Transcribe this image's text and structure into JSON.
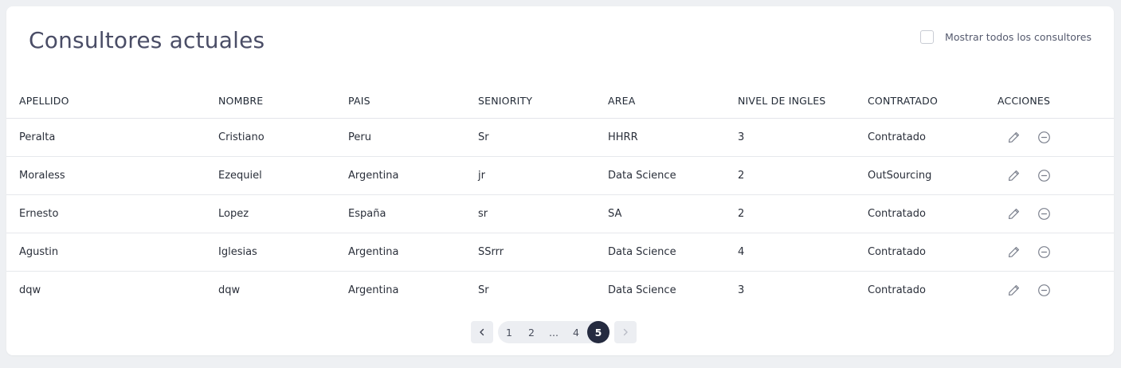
{
  "page": {
    "title": "Consultores actuales",
    "show_all_label": "Mostrar todos los consultores",
    "show_all_checked": false
  },
  "table": {
    "headers": [
      "APELLIDO",
      "NOMBRE",
      "PAIS",
      "SENIORITY",
      "AREA",
      "NIVEL DE INGLES",
      "CONTRATADO",
      "ACCIONES"
    ],
    "rows": [
      [
        "Peralta",
        "Cristiano",
        "Peru",
        "Sr",
        "HHRR",
        "3",
        "Contratado"
      ],
      [
        "Moraless",
        "Ezequiel",
        "Argentina",
        "jr",
        "Data Science",
        "2",
        "OutSourcing"
      ],
      [
        "Ernesto",
        "Lopez",
        "España",
        "sr",
        "SA",
        "2",
        "Contratado"
      ],
      [
        "Agustin",
        "Iglesias",
        "Argentina",
        "SSrrr",
        "Data Science",
        "4",
        "Contratado"
      ],
      [
        "dqw",
        "dqw",
        "Argentina",
        "Sr",
        "Data Science",
        "3",
        "Contratado"
      ]
    ],
    "row_actions": [
      "pencil-icon",
      "minus-circle-icon"
    ]
  },
  "pagination": {
    "pages": [
      "1",
      "2",
      "...",
      "4",
      "5"
    ],
    "current": "5",
    "prev_icon": "chevron-left-icon",
    "next_icon": "chevron-right-icon",
    "next_disabled": true
  },
  "colors": {
    "title": "#4a4d66",
    "active_page_bg": "#252b40",
    "page_bg": "#eef0f3"
  }
}
